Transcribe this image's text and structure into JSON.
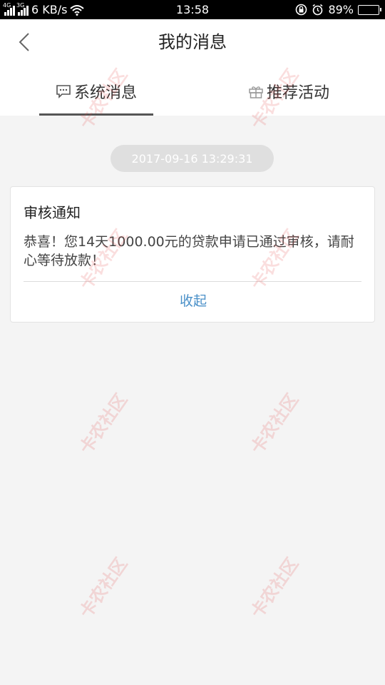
{
  "status": {
    "net1": "4G",
    "net2": "3G",
    "speed": "6 KB/s",
    "time": "13:58",
    "battery_pct": "89%",
    "battery_level": 0.89
  },
  "header": {
    "title": "我的消息"
  },
  "tabs": [
    {
      "label": "系统消息",
      "icon": "chat-bubble-icon",
      "active": true
    },
    {
      "label": "推荐活动",
      "icon": "gift-icon",
      "active": false
    }
  ],
  "message": {
    "timestamp": "2017-09-16 13:29:31",
    "title": "审核通知",
    "body": "恭喜！您14天1000.00元的贷款申请已通过审核，请耐心等待放款！",
    "collapse_label": "收起"
  },
  "watermark": "卡农社区",
  "colors": {
    "accent_link": "#4a90c8",
    "tab_indicator": "#555555",
    "timestamp_pill": "#dfdfdf",
    "page_background": "#f4f4f4"
  }
}
